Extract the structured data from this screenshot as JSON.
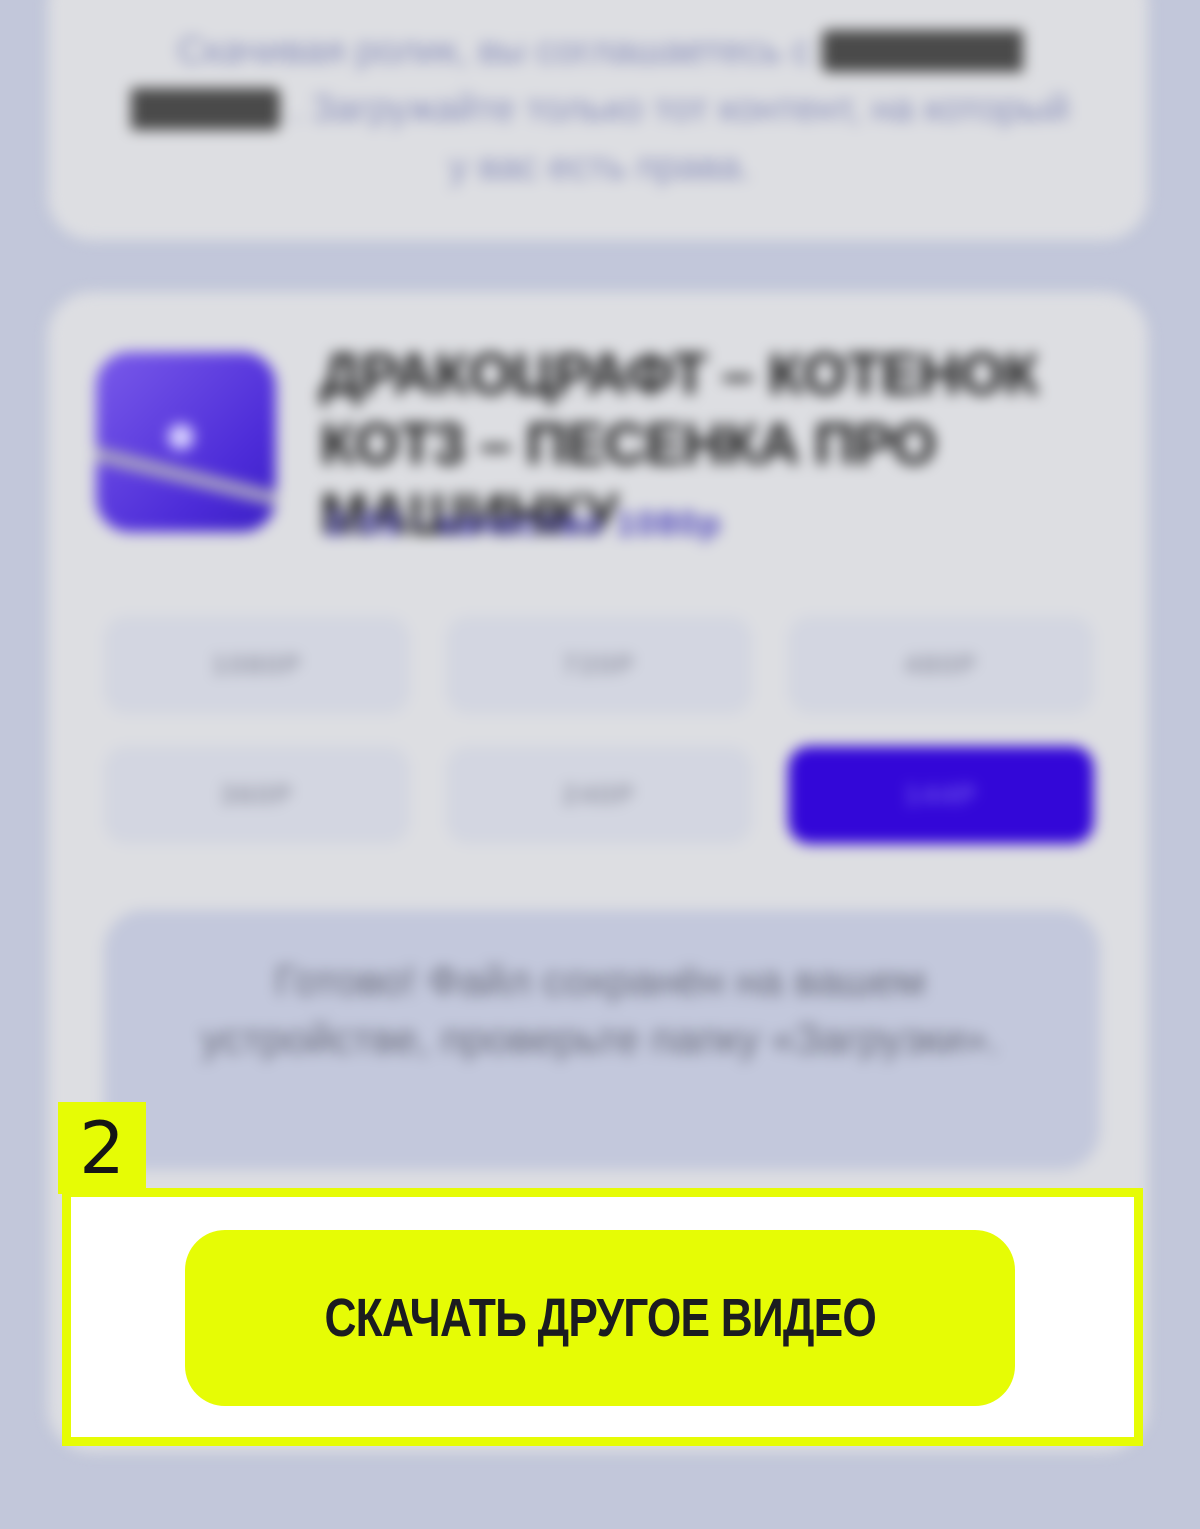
{
  "step": {
    "number": "2"
  },
  "notice": {
    "text_start": "Скачивая ролик, вы соглашаетесь с",
    "link": "правилами сервиса",
    "text_end": ". Загружайте только тот контент, на который у вас есть права."
  },
  "video": {
    "title": "Дракоцрафт – котенок кот3 – песенка про машинку",
    "meta": "2:03 · качество 1080p"
  },
  "quality": {
    "options": [
      {
        "label": "1080P"
      },
      {
        "label": "720P"
      },
      {
        "label": "480P"
      },
      {
        "label": "360P"
      },
      {
        "label": "240P"
      },
      {
        "label": "144P",
        "selected": true
      }
    ]
  },
  "tip": {
    "text": "Готово! Файл сохранён на вашем устройстве, проверьте папку «Загрузки»."
  },
  "actions": {
    "download_another": "СКАЧАТЬ ДРУГОЕ ВИДЕО"
  },
  "colors": {
    "accent": "#e6fc05",
    "brand": "#3307d8",
    "background": "#c2c7da"
  }
}
